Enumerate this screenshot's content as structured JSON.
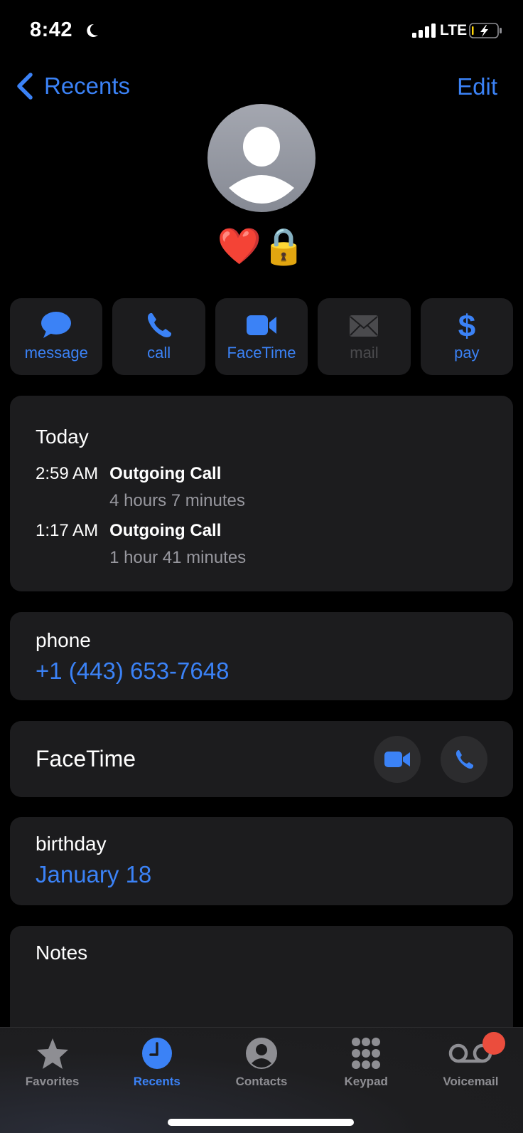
{
  "status_bar": {
    "time": "8:42",
    "focus_icon": "moon-icon",
    "network": "LTE",
    "battery_charging": true
  },
  "nav": {
    "back_label": "Recents",
    "edit_label": "Edit"
  },
  "contact": {
    "name": "❤️🔒"
  },
  "actions": [
    {
      "label": "message",
      "icon": "message-bubble-icon",
      "enabled": true
    },
    {
      "label": "call",
      "icon": "phone-icon",
      "enabled": true
    },
    {
      "label": "FaceTime",
      "icon": "video-icon",
      "enabled": true
    },
    {
      "label": "mail",
      "icon": "envelope-icon",
      "enabled": false
    },
    {
      "label": "pay",
      "icon": "dollar-icon",
      "enabled": true
    }
  ],
  "recents": {
    "title": "Today",
    "calls": [
      {
        "time": "2:59 AM",
        "type": "Outgoing Call",
        "duration": "4 hours 7 minutes"
      },
      {
        "time": "1:17 AM",
        "type": "Outgoing Call",
        "duration": "1 hour 41 minutes"
      }
    ]
  },
  "phone": {
    "label": "phone",
    "value": "+1 (443) 653-7648"
  },
  "facetime": {
    "label": "FaceTime"
  },
  "birthday": {
    "label": "birthday",
    "value": "January 18"
  },
  "notes": {
    "label": "Notes",
    "value": ""
  },
  "tab_bar": {
    "tabs": [
      {
        "label": "Favorites",
        "icon": "star-icon",
        "active": false
      },
      {
        "label": "Recents",
        "icon": "clock-icon",
        "active": true
      },
      {
        "label": "Contacts",
        "icon": "person-circle-icon",
        "active": false
      },
      {
        "label": "Keypad",
        "icon": "keypad-icon",
        "active": false
      },
      {
        "label": "Voicemail",
        "icon": "voicemail-icon",
        "active": false,
        "badge": true
      }
    ]
  },
  "colors": {
    "accent": "#3b82f6",
    "card": "#1c1c1e",
    "badge": "#eb4d3d",
    "secondary_text": "#98989f"
  }
}
